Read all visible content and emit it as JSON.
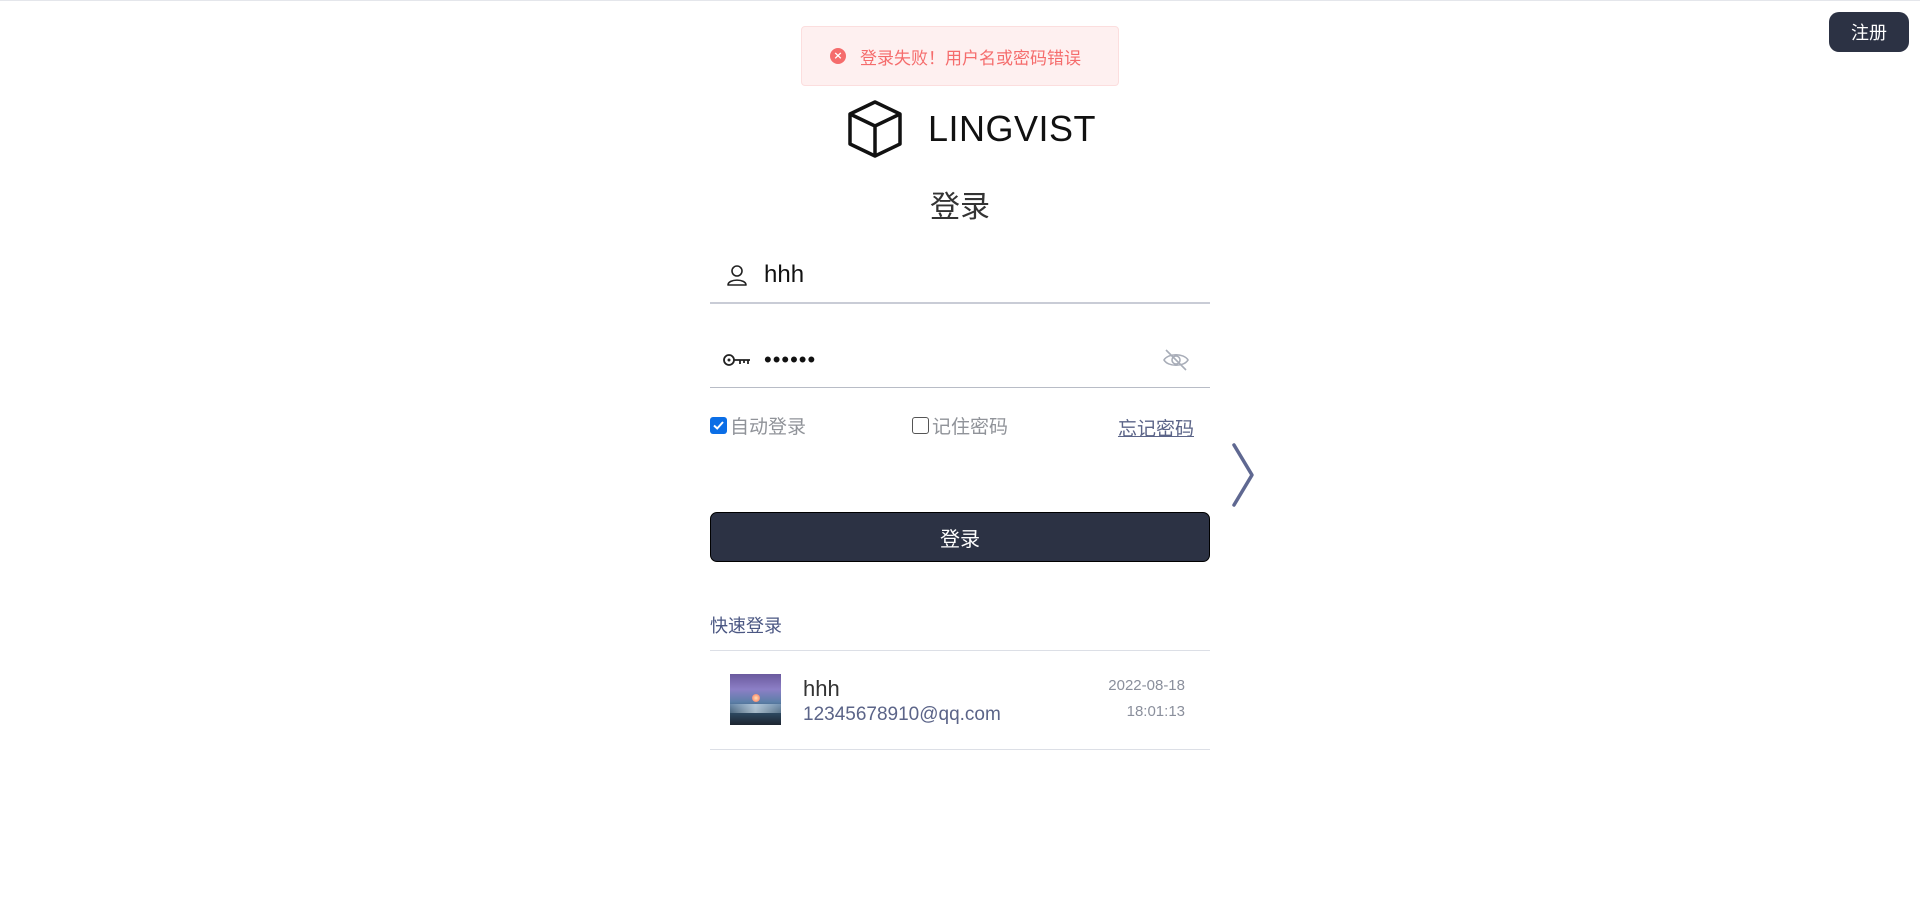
{
  "header": {
    "register_label": "注册"
  },
  "toast": {
    "message": "登录失败！用户名或密码错误",
    "icon": "error-circle-icon",
    "color": "#f56c6c"
  },
  "brand": {
    "name": "LINGVIST",
    "icon": "cube-icon"
  },
  "page_title": "登录",
  "form": {
    "username": {
      "value": "hhh",
      "icon": "user-icon"
    },
    "password": {
      "value": "••••••",
      "icon": "key-icon",
      "toggle_icon": "eye-off-icon"
    },
    "auto_login": {
      "label": "自动登录",
      "checked": true
    },
    "remember_password": {
      "label": "记住密码",
      "checked": false
    },
    "forgot_label": "忘记密码",
    "login_label": "登录"
  },
  "quick_login": {
    "title": "快速登录",
    "accounts": [
      {
        "name": "hhh",
        "email": "12345678910@qq.com",
        "date": "2022-08-18",
        "time": "18:01:13"
      }
    ]
  },
  "colors": {
    "primary_dark": "#2c3244",
    "accent_blue": "#0b6ee6",
    "link": "#5b6488"
  }
}
